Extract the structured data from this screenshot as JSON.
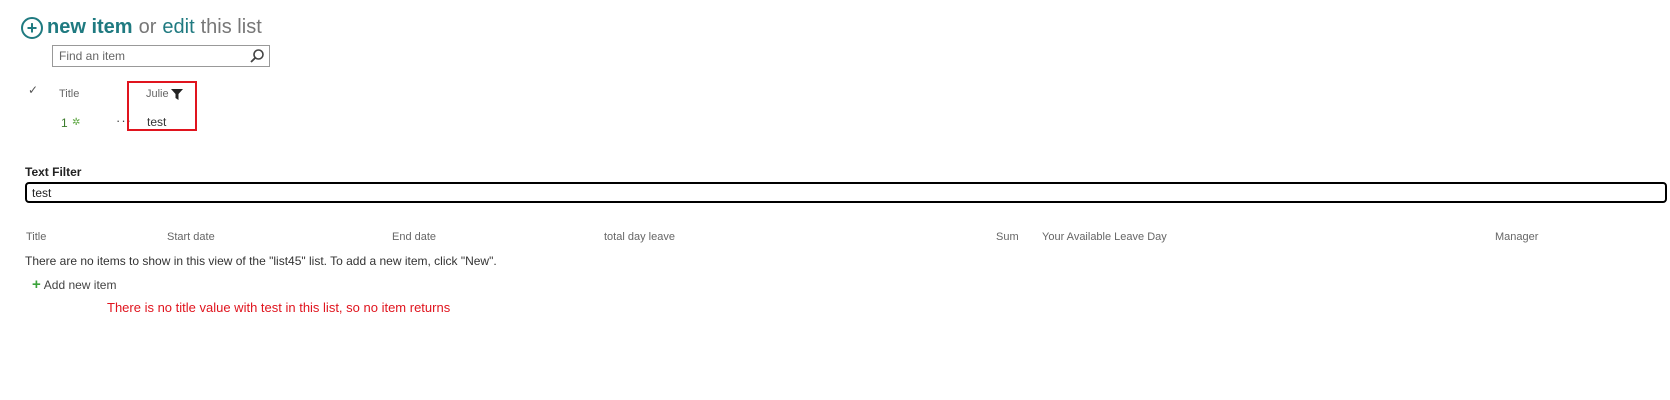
{
  "header": {
    "new_item_label": "new item",
    "or_text": "or",
    "edit_label": "edit",
    "list_text": "this list"
  },
  "search": {
    "placeholder": "Find an item"
  },
  "list_view": {
    "columns": [
      "Title",
      "Julie"
    ],
    "rows": [
      {
        "title": "1",
        "julie": "test"
      }
    ]
  },
  "text_filter": {
    "label": "Text Filter",
    "value": "test"
  },
  "second_view": {
    "columns": [
      "Title",
      "Start date",
      "End date",
      "total day leave",
      "Sum",
      "Your Available Leave Day",
      "Manager"
    ],
    "empty_message": "There are no items to show in this view of the \"list45\" list. To add a new item, click \"New\".",
    "add_new_item_label": "Add new item"
  },
  "annotation": "There is no title value with test in this list, so no item returns",
  "colors": {
    "accent": "#1f7a80",
    "highlight": "#e0141e",
    "add_green": "#3aa33a"
  }
}
